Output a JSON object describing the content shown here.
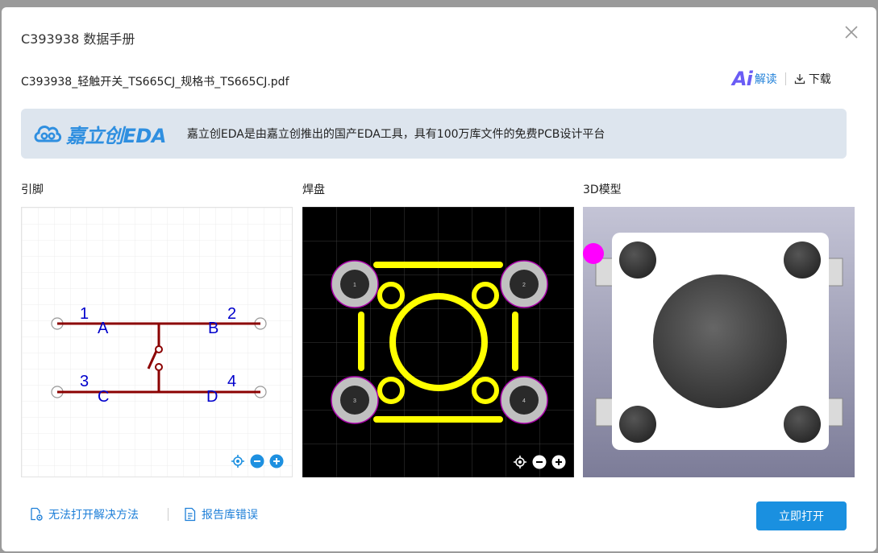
{
  "dialog": {
    "title": "C393938 数据手册",
    "filename": "C393938_轻触开关_TS665CJ_规格书_TS665CJ.pdf",
    "ai_logo": "Ai",
    "ai_label": "解读",
    "download_label": "下载"
  },
  "banner": {
    "logo_text": "嘉立创EDA",
    "description": "嘉立创EDA是由嘉立创推出的国产EDA工具，具有100万库文件的免费PCB设计平台"
  },
  "sections": {
    "pins_label": "引脚",
    "pads_label": "焊盘",
    "model_label": "3D模型"
  },
  "schematic": {
    "pin_numbers": [
      "1",
      "2",
      "3",
      "4"
    ],
    "pin_names": [
      "A",
      "B",
      "C",
      "D"
    ]
  },
  "footprint": {
    "pad_numbers": [
      "1",
      "2",
      "3",
      "4"
    ]
  },
  "footer": {
    "cannot_open_label": "无法打开解决方法",
    "report_error_label": "报告库错误",
    "open_now_label": "立即打开"
  },
  "colors": {
    "accent": "#1a90e0",
    "link": "#1e7fd8",
    "ai_purple": "#6a5cf5",
    "banner_bg": "#dde5ee",
    "schematic_line": "#8b0000",
    "schematic_text": "#0000cc",
    "pad_silk": "#ffff00",
    "pad_ring": "#c0c0c0"
  },
  "icons": [
    "close-icon",
    "download-icon",
    "cloud-logo-icon",
    "locate-icon",
    "zoom-out-icon",
    "zoom-in-icon",
    "settings-doc-icon",
    "report-doc-icon"
  ]
}
